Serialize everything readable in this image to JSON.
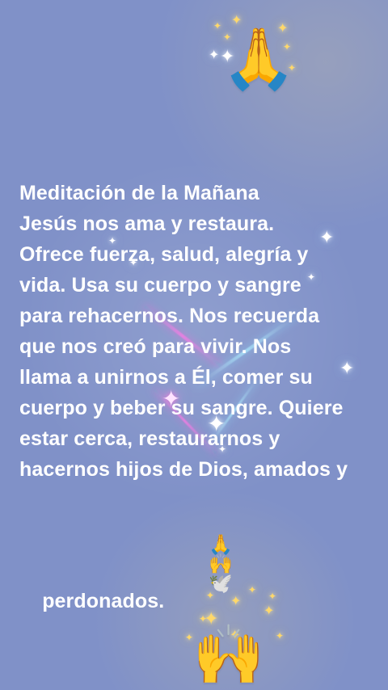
{
  "palette": {
    "background": "#8091c8",
    "text": "#ffffff",
    "sparkle_gold": "#ffd86a",
    "sparkle_white": "#ffffff",
    "sparkle_pink": "#ffe3ff"
  },
  "decor": {
    "top_icon": "praying-hands-icon",
    "bottom_icon": "raised-hands-icon",
    "inline_icons": [
      "praying-hands-icon",
      "raised-hands-icon",
      "dove-icon"
    ],
    "top_emoji": "🙏",
    "bottom_emoji": "🙌",
    "inline_emoji_1": "🙏",
    "inline_emoji_2": "🙌",
    "inline_emoji_3": "🕊️"
  },
  "message": {
    "lines": [
      "Meditación de la Mañana",
      "Jesús nos ama y restaura.",
      "Ofrece fuerza, salud, alegría y",
      "vida. Usa su cuerpo y sangre",
      "para rehacernos. Nos recuerda",
      "que nos creó para vivir. Nos",
      "llama a unirnos a Él, comer su",
      "cuerpo y beber su sangre. Quiere",
      "estar cerca, restaurarnos y",
      "hacernos hijos de Dios, amados y",
      "perdonados."
    ]
  }
}
